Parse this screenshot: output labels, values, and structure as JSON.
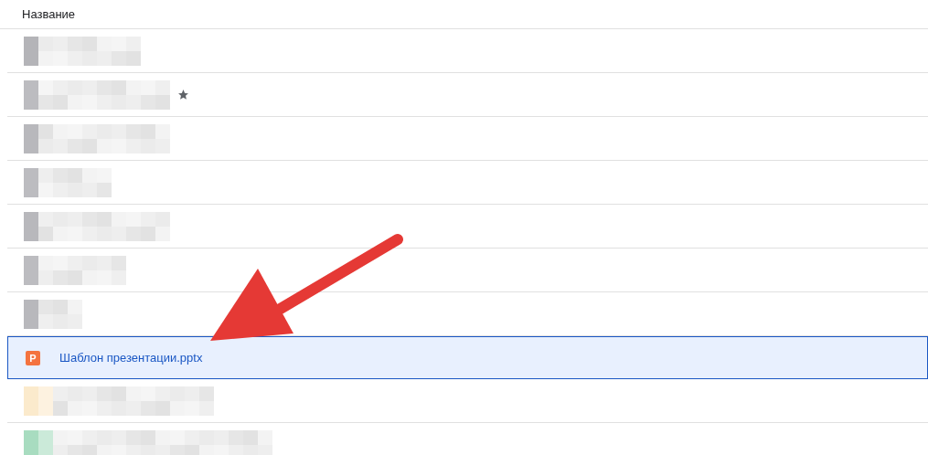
{
  "table": {
    "columns": [
      {
        "label": "Название"
      }
    ],
    "rows": [
      {
        "kind": "redacted",
        "color": "#b4b4b8",
        "starred": false
      },
      {
        "kind": "redacted",
        "color": "#bcbcc0",
        "starred": true
      },
      {
        "kind": "redacted",
        "color": "#b8b8bc",
        "starred": false
      },
      {
        "kind": "redacted",
        "color": "#bcbcc0",
        "starred": false
      },
      {
        "kind": "redacted",
        "color": "#b8b8bc",
        "starred": false
      },
      {
        "kind": "redacted",
        "color": "#bcbcc0",
        "starred": false
      },
      {
        "kind": "redacted",
        "color": "#b8b8bc",
        "starred": false
      },
      {
        "kind": "file",
        "icon_letter": "P",
        "name": "Шаблон презентации.pptx",
        "selected": true
      },
      {
        "kind": "redacted",
        "color": "#fbeacc",
        "starred": false
      },
      {
        "kind": "redacted",
        "color": "#a8dcc0",
        "starred": false
      }
    ]
  },
  "annotation": {
    "kind": "arrow"
  }
}
